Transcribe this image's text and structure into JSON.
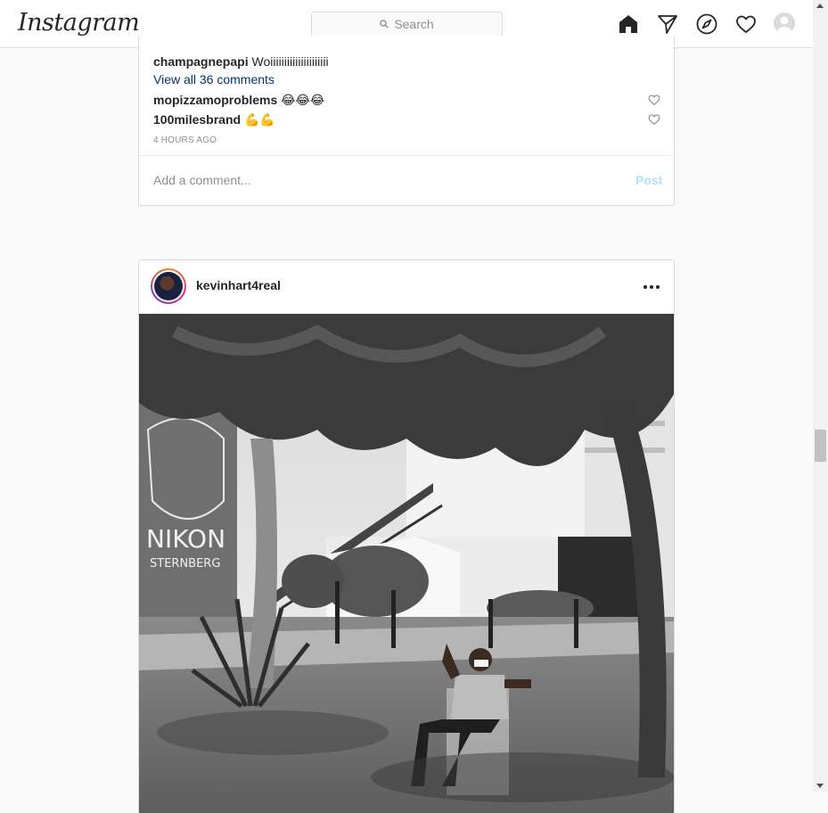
{
  "nav": {
    "logo": "Instagram",
    "search_placeholder": "Search",
    "icons": [
      "home-icon",
      "direct-icon",
      "explore-icon",
      "activity-icon",
      "profile-avatar"
    ]
  },
  "post1": {
    "caption_comment": {
      "user": "champagnepapi",
      "text": "Woiiiiiiiiiiiiiiiiiiiii"
    },
    "view_all": "View all 36 comments",
    "comments": [
      {
        "user": "mopizzamoproblems",
        "text": "😂😂😂"
      },
      {
        "user": "100milesbrand",
        "text": "💪💪"
      }
    ],
    "timestamp": "4 HOURS AGO",
    "add_comment_placeholder": "Add a comment...",
    "post_label": "Post"
  },
  "post2": {
    "username": "kevinhart4real",
    "photo_text": [
      "NIKON",
      "STERNBERG"
    ]
  },
  "colors": {
    "link": "#00376b",
    "post_disabled": "#b2dffc",
    "border": "#dbdbdb",
    "background": "#fafafa"
  }
}
